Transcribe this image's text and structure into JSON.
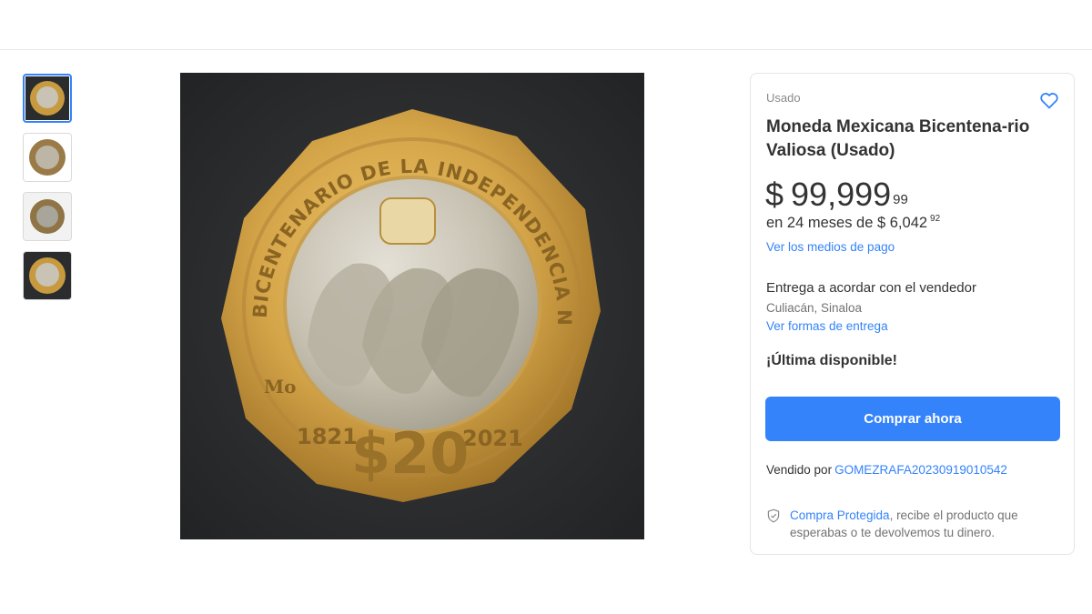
{
  "gallery": {
    "thumbnails": [
      {
        "alt": "coin-front"
      },
      {
        "alt": "coin-back"
      },
      {
        "alt": "coin-angle"
      },
      {
        "alt": "coin-front-2"
      }
    ],
    "main_image_alt": "Moneda $20 Bicentenario de la Independencia Nacional 1821 2021"
  },
  "coin_text": {
    "rim": "BICENTENARIO DE LA INDEPENDENCIA NACIONAL",
    "year_left": "1821",
    "year_right": "2021",
    "denomination": "$20",
    "mint_mark": "Mo"
  },
  "product": {
    "condition": "Usado",
    "title": "Moneda Mexicana Bicentena-rio Valiosa (Usado)",
    "price_currency": "$",
    "price_int": "99,999",
    "price_cents": "99",
    "installments_text": "en 24 meses de $ 6,042",
    "installments_cents": "92",
    "payment_link": "Ver los medios de pago",
    "delivery_text": "Entrega a acordar con el vendedor",
    "location": "Culiacán, Sinaloa",
    "shipping_link": "Ver formas de entrega",
    "stock_text": "¡Última disponible!",
    "buy_button": "Comprar ahora",
    "seller_label": "Vendido por",
    "seller_name": "GOMEZRAFA20230919010542",
    "protect_link": "Compra Protegida",
    "protect_text": ", recibe el producto que esperabas o te devolvemos tu dinero."
  },
  "icons": {
    "favorite": "heart-icon",
    "protection": "shield-check-icon"
  },
  "colors": {
    "accent": "#3483fa",
    "coin_gold": "#c99a3c",
    "coin_silver": "#c9c4b6"
  }
}
